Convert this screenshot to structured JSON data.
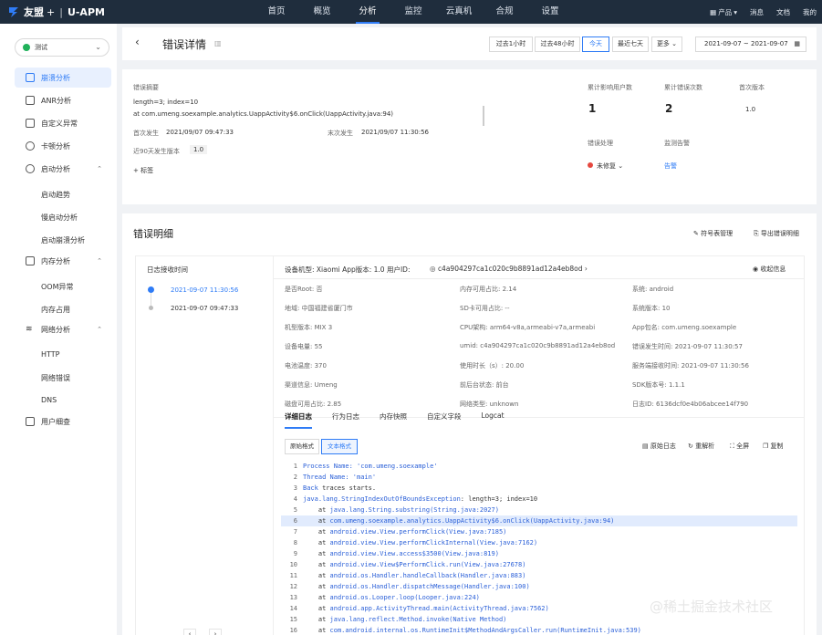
{
  "brand": {
    "name": "友盟",
    "plus": "+",
    "product": "U-APM"
  },
  "top_nav": [
    "首页",
    "概览",
    "分析",
    "监控",
    "云真机",
    "合规",
    "设置"
  ],
  "top_right": {
    "product": "产品",
    "messages": "消息",
    "docs": "文档",
    "mine": "我的"
  },
  "app_select": {
    "value": "测试"
  },
  "sidebar": {
    "items": [
      "崩溃分析",
      "ANR分析",
      "自定义异常",
      "卡顿分析",
      "启动分析",
      "内存分析",
      "网络分析",
      "用户细查"
    ],
    "startup_sub": [
      "启动趋势",
      "慢启动分析",
      "启动崩溃分析"
    ],
    "memory_sub": [
      "OOM异常",
      "内存占用"
    ],
    "network_sub": [
      "HTTP",
      "网络错误",
      "DNS"
    ]
  },
  "header": {
    "title": "错误详情",
    "time_buttons": [
      "过去1小时",
      "过去48小时",
      "今天",
      "最近七天",
      "更多"
    ],
    "date_range": "2021-09-07 ~ 2021-09-07"
  },
  "summary": {
    "label": "错误摘要",
    "line1": "length=3; index=10",
    "line2": "at com.umeng.soexample.analytics.UappActivity$6.onClick(UappActivity.java:94)",
    "first_label": "首次发生",
    "first_value": "2021/09/07 09:47:33",
    "last_label": "末次发生",
    "last_value": "2021/09/07 11:30:56",
    "recent_label": "近90天发生版本",
    "recent_value": "1.0",
    "tag_button": "+ 标签",
    "users_label": "累计影响用户数",
    "users_value": "1",
    "count_label": "累计错误次数",
    "count_value": "2",
    "version_label": "首次版本",
    "version_value": "1.0",
    "handling_label": "错误处理",
    "handling_value": "未修复",
    "alert_label": "监测告警",
    "alert_value": "告警"
  },
  "detail": {
    "title": "错误明细",
    "symbol_mgmt": "符号表管理",
    "export": "导出错误明细",
    "log_header": "日志接收时间",
    "log_times": [
      "2021-09-07 11:30:56",
      "2021-09-07 09:47:33"
    ],
    "device_line": "设备机型: Xiaomi    App版本: 1.0    用户ID:",
    "user_id": "c4a904297ca1c020c9b8891ad12a4eb8od",
    "collapse": "收起信息",
    "info": [
      [
        "是否Root: 否",
        "内存可用占比: 2.14",
        "系统: android"
      ],
      [
        "地域: 中国福建省厦门市",
        "SD卡可用占比: --",
        "系统版本: 10"
      ],
      [
        "机型版本: MIX 3",
        "CPU架构: arm64-v8a,armeabi-v7a,armeabi",
        "App包名: com.umeng.soexample"
      ],
      [
        "设备电量: 55",
        "umid: c4a904297ca1c020c9b8891ad12a4eb8od",
        "错误发生时间: 2021-09-07 11:30:57"
      ],
      [
        "电池温度: 370",
        "使用时长（s）: 20.00",
        "服务端接收时间: 2021-09-07 11:30:56"
      ],
      [
        "渠道信息: Umeng",
        "前后台状态: 前台",
        "SDK版本号: 1.1.1"
      ],
      [
        "磁盘可用占比: 2.85",
        "网络类型: unknown",
        "日志ID: 6136dcf0e4b06abcee14f790"
      ]
    ],
    "tabs": [
      "详细日志",
      "行为日志",
      "内存快照",
      "自定义字段",
      "Logcat"
    ],
    "format_buttons": [
      "原始格式",
      "文本格式"
    ],
    "actions": [
      "原始日志",
      "重解析",
      "全屏",
      "复制"
    ],
    "code": [
      {
        "n": "1",
        "pre": "",
        "link": "Process Name: 'com.umeng.soexample'",
        "post": ""
      },
      {
        "n": "2",
        "pre": "",
        "link": "Thread Name: 'main'",
        "post": ""
      },
      {
        "n": "3",
        "pre": "",
        "link": "Back",
        "post": " traces starts."
      },
      {
        "n": "4",
        "pre": "",
        "link": "java.lang.StringIndexOutOfBoundsException",
        "post": ": length=3; index=10"
      },
      {
        "n": "5",
        "pre": "    at ",
        "link": "java.lang.String.substring(String.java:2027)",
        "post": ""
      },
      {
        "n": "6",
        "pre": "    at ",
        "link": "com.umeng.soexample.analytics.UappActivity$6.onClick(UappActivity.java:94)",
        "post": ""
      },
      {
        "n": "7",
        "pre": "    at ",
        "link": "android.view.View.performClick(View.java:7185)",
        "post": ""
      },
      {
        "n": "8",
        "pre": "    at ",
        "link": "android.view.View.performClickInternal(View.java:7162)",
        "post": ""
      },
      {
        "n": "9",
        "pre": "    at ",
        "link": "android.view.View.access$3500(View.java:819)",
        "post": ""
      },
      {
        "n": "10",
        "pre": "    at ",
        "link": "android.view.View$PerformClick.run(View.java:27678)",
        "post": ""
      },
      {
        "n": "11",
        "pre": "    at ",
        "link": "android.os.Handler.handleCallback(Handler.java:883)",
        "post": ""
      },
      {
        "n": "12",
        "pre": "    at ",
        "link": "android.os.Handler.dispatchMessage(Handler.java:100)",
        "post": ""
      },
      {
        "n": "13",
        "pre": "    at ",
        "link": "android.os.Looper.loop(Looper.java:224)",
        "post": ""
      },
      {
        "n": "14",
        "pre": "    at ",
        "link": "android.app.ActivityThread.main(ActivityThread.java:7562)",
        "post": ""
      },
      {
        "n": "15",
        "pre": "    at ",
        "link": "java.lang.reflect.Method.invoke(Native Method)",
        "post": ""
      },
      {
        "n": "16",
        "pre": "    at ",
        "link": "com.android.internal.os.RuntimeInit$MethodAndArgsCaller.run(RuntimeInit.java:539)",
        "post": ""
      }
    ]
  },
  "watermark": "@稀土掘金技术社区"
}
